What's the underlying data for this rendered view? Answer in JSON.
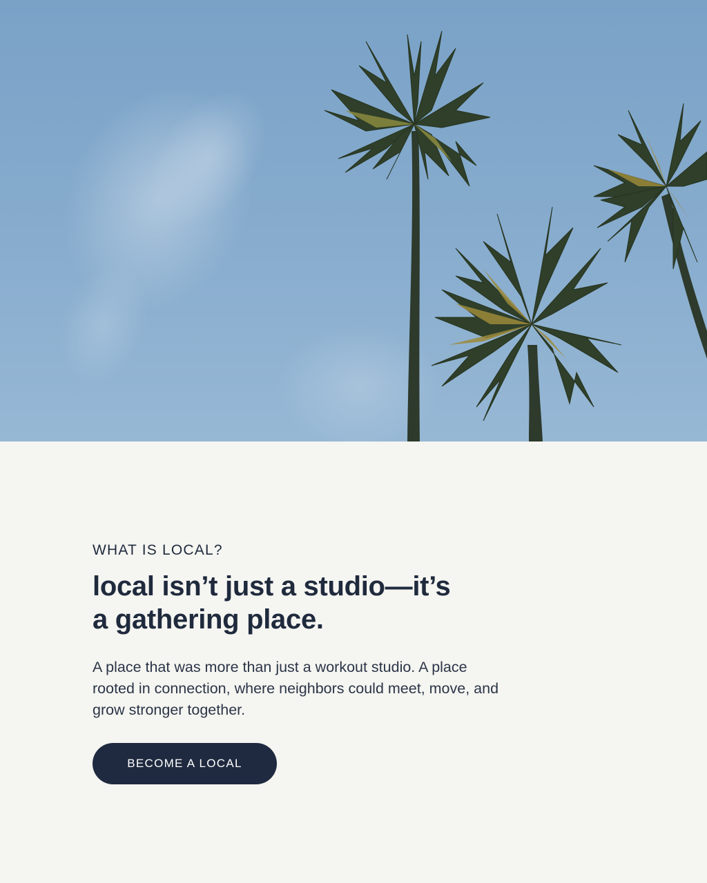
{
  "hero": {
    "image": "palm-trees-blue-sky-photo"
  },
  "section": {
    "eyebrow": "WHAT IS LOCAL?",
    "headline_line1": "local isn’t just a studio—it’s",
    "headline_line2": "a gathering place.",
    "body": "A place that was more than just a workout studio. A place rooted in connection, where neighbors could meet, move, and grow stronger together.",
    "cta_label": "BECOME A LOCAL"
  },
  "colors": {
    "background": "#f5f5f1",
    "text": "#1f2a3d",
    "button": "#1f2a40",
    "sky": "#86abcd"
  }
}
